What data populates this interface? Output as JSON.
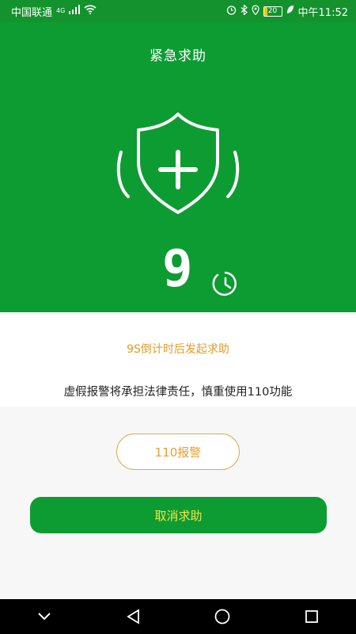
{
  "status_bar": {
    "carrier": "中国联通",
    "network": "4G",
    "battery": "20",
    "time": "中午11:52",
    "icons": [
      "signal-icon",
      "wifi-icon",
      "alarm-icon",
      "bluetooth-icon",
      "location-icon",
      "battery-icon",
      "leaf-icon"
    ]
  },
  "header": {
    "title": "紧急求助"
  },
  "hero": {
    "countdown_digit": "9",
    "icons": [
      "shield-plus-icon",
      "clock-icon"
    ]
  },
  "info": {
    "countdown_text": "9S倒计时后发起求助",
    "warning_text": "虚假报警将承担法律责任，慎重使用110功能"
  },
  "actions": {
    "police_label": "110报警",
    "cancel_label": "取消求助"
  },
  "colors": {
    "primary_green": "#0d9c32",
    "accent_orange": "#e3a233",
    "cancel_text": "#f3e34a"
  },
  "nav_bar": {
    "icons": [
      "chevron-down-icon",
      "back-icon",
      "home-icon",
      "recents-icon"
    ]
  }
}
